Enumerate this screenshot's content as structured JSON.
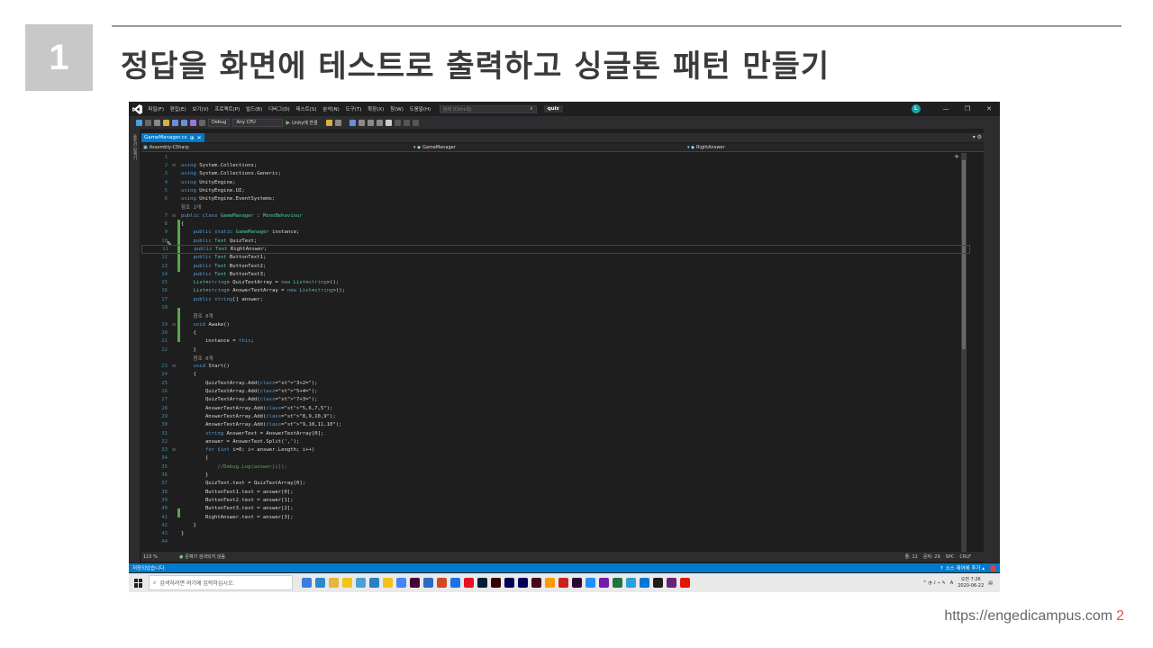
{
  "slide": {
    "number": "1",
    "title": "정답을 화면에 테스트로 출력하고 싱글톤 패턴 만들기",
    "footer_url": "https://engedicampus.com",
    "page": "2"
  },
  "vs": {
    "menu": [
      "파일(F)",
      "편집(E)",
      "보기(V)",
      "프로젝트(P)",
      "빌드(B)",
      "디버그(D)",
      "테스트(S)",
      "분석(N)",
      "도구(T)",
      "확장(X)",
      "창(W)",
      "도움말(H)"
    ],
    "search_placeholder": "검색 (Ctrl+Q)",
    "project": "quiz",
    "user_initial": "L",
    "toolbar": {
      "config": "Debug",
      "platform": "Any CPU",
      "run": "Unity에 연결"
    },
    "left_strip": "솔루션 탐색기",
    "tab": "GameManager.cs",
    "nav": {
      "project": "Assembly-CSharp",
      "class": "GameManager",
      "member": "RightAnswer"
    },
    "status": {
      "zoom": "115 %",
      "issues": "문제가 검색되지 않음",
      "line": "줄: 11",
      "char": "문자: 29",
      "spc": "SPC",
      "crlf": "CRLF",
      "saved": "저장되었습니다.",
      "source_control": "소스 제어에 추가"
    }
  },
  "code": [
    {
      "n": "1",
      "f": "",
      "t": ""
    },
    {
      "n": "2",
      "f": "⊟",
      "t": "using System.Collections;"
    },
    {
      "n": "3",
      "f": "",
      "t": "using System.Collections.Generic;"
    },
    {
      "n": "4",
      "f": "",
      "t": "using UnityEngine;"
    },
    {
      "n": "5",
      "f": "",
      "t": "using UnityEngine.UI;"
    },
    {
      "n": "6",
      "f": "",
      "t": "using UnityEngine.EventSystems;"
    },
    {
      "n": "",
      "f": "",
      "t": "참조 2개",
      "ref": true
    },
    {
      "n": "7",
      "f": "⊟",
      "t": "public class GameManager : MonoBehaviour"
    },
    {
      "n": "8",
      "f": "",
      "t": "{"
    },
    {
      "n": "9",
      "f": "",
      "t": "    public static GameManager instance;"
    },
    {
      "n": "10",
      "f": "",
      "t": "    public Text QuizText;"
    },
    {
      "n": "11",
      "f": "",
      "t": "    public Text RightAnswer;",
      "hl": true
    },
    {
      "n": "12",
      "f": "",
      "t": "    public Text ButtonText1;"
    },
    {
      "n": "13",
      "f": "",
      "t": "    public Text ButtonText2;"
    },
    {
      "n": "14",
      "f": "",
      "t": "    public Text ButtonText3;"
    },
    {
      "n": "15",
      "f": "",
      "t": "    List<string> QuizTextArray = new List<string>();"
    },
    {
      "n": "16",
      "f": "",
      "t": "    List<string> AnswerTextArray = new List<string>();"
    },
    {
      "n": "17",
      "f": "",
      "t": "    public string[] answer;"
    },
    {
      "n": "18",
      "f": "",
      "t": ""
    },
    {
      "n": "",
      "f": "",
      "t": "    참조 0개",
      "ref": true
    },
    {
      "n": "19",
      "f": "⊟",
      "t": "    void Awake()"
    },
    {
      "n": "20",
      "f": "",
      "t": "    {"
    },
    {
      "n": "21",
      "f": "",
      "t": "        instance = this;"
    },
    {
      "n": "22",
      "f": "",
      "t": "    }"
    },
    {
      "n": "",
      "f": "",
      "t": "    참조 0개",
      "ref": true
    },
    {
      "n": "23",
      "f": "⊟",
      "t": "    void Start()"
    },
    {
      "n": "24",
      "f": "",
      "t": "    {"
    },
    {
      "n": "25",
      "f": "",
      "t": "        QuizTextArray.Add(\"3+2=\");"
    },
    {
      "n": "26",
      "f": "",
      "t": "        QuizTextArray.Add(\"5+4=\");"
    },
    {
      "n": "27",
      "f": "",
      "t": "        QuizTextArray.Add(\"7+3=\");"
    },
    {
      "n": "28",
      "f": "",
      "t": "        AnswerTextArray.Add(\"5,6,7,5\");"
    },
    {
      "n": "29",
      "f": "",
      "t": "        AnswerTextArray.Add(\"8,9,10,9\");"
    },
    {
      "n": "30",
      "f": "",
      "t": "        AnswerTextArray.Add(\"9,10,11,10\");"
    },
    {
      "n": "31",
      "f": "",
      "t": "        string AnswerText = AnswerTextArray[0];"
    },
    {
      "n": "32",
      "f": "",
      "t": "        answer = AnswerText.Split(',');"
    },
    {
      "n": "33",
      "f": "⊟",
      "t": "        for (int i=0; i< answer.Length; i++)"
    },
    {
      "n": "34",
      "f": "",
      "t": "        {"
    },
    {
      "n": "35",
      "f": "",
      "t": "            //Debug.Log(answer[i]);",
      "cm": true
    },
    {
      "n": "36",
      "f": "",
      "t": "        }"
    },
    {
      "n": "37",
      "f": "",
      "t": "        QuizText.text = QuizTextArray[0];"
    },
    {
      "n": "38",
      "f": "",
      "t": "        ButtonText1.text = answer[0];"
    },
    {
      "n": "39",
      "f": "",
      "t": "        ButtonText2.text = answer[1];"
    },
    {
      "n": "40",
      "f": "",
      "t": "        ButtonText3.text = answer[2];"
    },
    {
      "n": "41",
      "f": "",
      "t": "        RightAnswer.text = answer[3];"
    },
    {
      "n": "42",
      "f": "",
      "t": "    }"
    },
    {
      "n": "43",
      "f": "",
      "t": "}"
    },
    {
      "n": "44",
      "f": "",
      "t": ""
    }
  ],
  "taskbar": {
    "search_placeholder": "검색하려면 여기에 입력하십시오.",
    "time": "오전 7:26",
    "date": "2020-06-22",
    "lang": "A",
    "app_colors": [
      "#3b7ddd",
      "#2d8ac9",
      "#e8b339",
      "#f0c419",
      "#4aa0d8",
      "#2680c2",
      "#f2c316",
      "#4285f4",
      "#470137",
      "#2a6cc0",
      "#d24726",
      "#1a73e8",
      "#e81123",
      "#001e36",
      "#330000",
      "#00005b",
      "#00005b",
      "#49021f",
      "#ff9a00",
      "#cc2020",
      "#2a0634",
      "#1e90ff",
      "#7719aa",
      "#217346",
      "#2aa0d8",
      "#0078d4",
      "#1e1e1e",
      "#68217a",
      "#e51400"
    ]
  }
}
